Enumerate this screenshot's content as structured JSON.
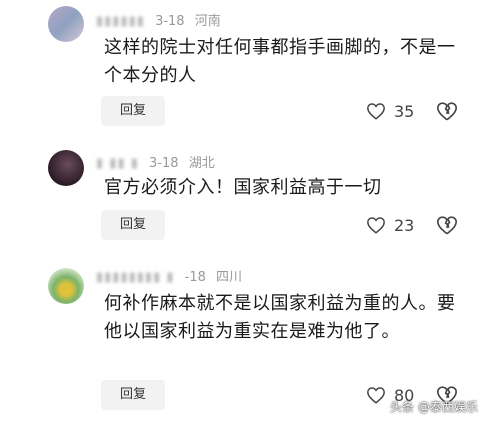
{
  "comments": [
    {
      "name": "▮▮▮▮▮▮",
      "date": "3-18",
      "location": "河南",
      "text": "这样的院士对任何事都指手画脚的，不是一个本分的人",
      "reply_label": "回复",
      "likes": "35"
    },
    {
      "name": "▮ ▮▮ ▮",
      "date": "3-18",
      "location": "湖北",
      "text": "官方必须介入！国家利益高于一切",
      "reply_label": "回复",
      "likes": "23"
    },
    {
      "name": "▮▮▮▮▮▮▮▮ ▮",
      "date": "-18",
      "location": "四川",
      "text": "何补作麻本就不是以国家利益为重的人。要他以国家利益为重实在是难为他了。",
      "reply_label": "回复",
      "likes": "80"
    }
  ],
  "watermark": "头条 @泰西娱乐"
}
